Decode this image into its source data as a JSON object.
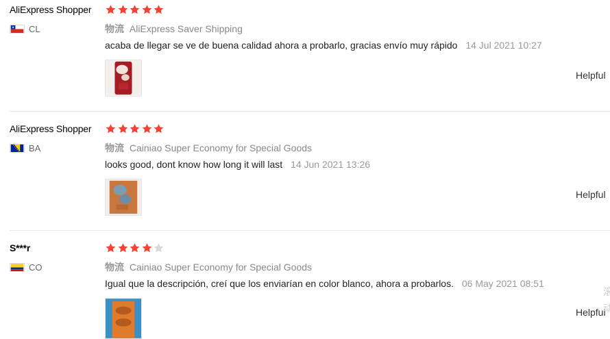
{
  "reviews": [
    {
      "user": "AliExpress Shopper",
      "country": "CL",
      "rating": 5,
      "shipping_label": "物流",
      "shipping": "AliExpress Saver Shipping",
      "comment": "acaba de llegar se ve de buena calidad ahora a probarlo, gracias envío muy rápido",
      "timestamp": "14 Jul 2021 10:27",
      "helpful": "Helpful"
    },
    {
      "user": "AliExpress Shopper",
      "country": "BA",
      "rating": 5,
      "shipping_label": "物流",
      "shipping": "Cainiao Super Economy for Special Goods",
      "comment": "looks good, dont know how long it will last",
      "timestamp": "14 Jun 2021 13:26",
      "helpful": "Helpful"
    },
    {
      "user": "S***r",
      "country": "CO",
      "rating": 4,
      "shipping_label": "物流",
      "shipping": "Cainiao Super Economy for Special Goods",
      "comment": "Igual que la descripción, creí que los enviarían en color blanco, ahora a probarlos.",
      "timestamp": "06 May 2021 08:51",
      "helpful": "Helpful"
    }
  ],
  "side_glyphs": [
    "滚",
    "动"
  ],
  "colors": {
    "star_filled": "#f44336",
    "star_empty": "#d9d9d9",
    "muted_text": "#999999"
  }
}
